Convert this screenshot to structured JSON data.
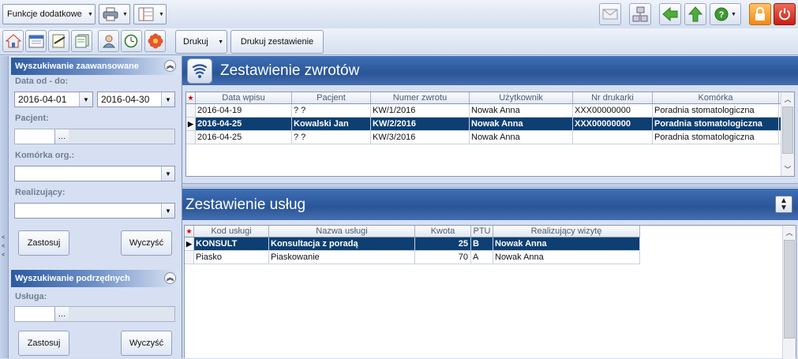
{
  "toolbar": {
    "funkcje_label": "Funkcje dodatkowe",
    "drukuj_label": "Drukuj",
    "drukuj_zestawienie_label": "Drukuj zestawienie"
  },
  "search_panel": {
    "title": "Wyszukiwanie zaawansowane",
    "date_label": "Data od - do:",
    "date_from": "2016-04-01",
    "date_to": "2016-04-30",
    "pacjent_label": "Pacjent:",
    "pacjent_value": "",
    "komorka_label": "Komórka org.:",
    "komorka_value": "",
    "realizujacy_label": "Realizujący:",
    "realizujacy_value": "",
    "apply_label": "Zastosuj",
    "clear_label": "Wyczyść"
  },
  "sub_panel": {
    "title": "Wyszukiwanie podrzędnych",
    "usluga_label": "Usługa:",
    "usluga_value": "",
    "apply_label": "Zastosuj",
    "clear_label": "Wyczyść"
  },
  "returns": {
    "title": "Zestawienie zwrotów",
    "columns": [
      "Data wpisu",
      "Pacjent",
      "Numer zwrotu",
      "Użytkownik",
      "Nr drukarki",
      "Komórka"
    ],
    "rows": [
      [
        "2016-04-19",
        "? ?",
        "KW/1/2016",
        "Nowak Anna",
        "XXX00000000",
        "Poradnia stomatologiczna"
      ],
      [
        "2016-04-25",
        "Kowalski Jan",
        "KW/2/2016",
        "Nowak Anna",
        "XXX00000000",
        "Poradnia stomatologiczna"
      ],
      [
        "2016-04-25",
        "? ?",
        "KW/3/2016",
        "Nowak Anna",
        "",
        "Poradnia stomatologiczna"
      ]
    ],
    "selected_row": 1
  },
  "services": {
    "title": "Zestawienie usług",
    "columns": [
      "Kod usługi",
      "Nazwa usługi",
      "Kwota",
      "PTU",
      "Realizujący wizytę"
    ],
    "rows": [
      [
        "KONSULT",
        "Konsultacja z poradą",
        "25",
        "B",
        "Nowak Anna"
      ],
      [
        "Piasko",
        "Piaskowanie",
        "70",
        "A",
        "Nowak Anna"
      ]
    ],
    "selected_row": 0
  },
  "colors": {
    "header_blue": "#2a5597",
    "selection": "#0e3f72",
    "panel_bg": "#d6e0f2"
  },
  "icons": {
    "toolbar_row1": [
      "printer-icon",
      "view-layout-icon",
      "mail-icon",
      "network-icon",
      "back-arrow-icon",
      "up-arrow-icon",
      "help-icon",
      "lock-icon",
      "power-icon"
    ],
    "toolbar_row2": [
      "home-icon",
      "calendar-icon",
      "prescription-icon",
      "documents-icon",
      "patients-icon",
      "clock-icon",
      "settings-flower-icon"
    ]
  }
}
